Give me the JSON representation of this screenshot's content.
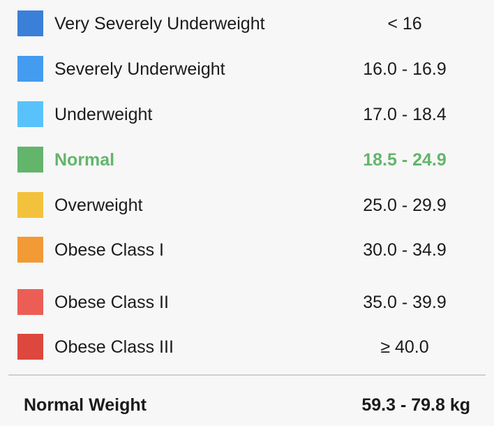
{
  "bmi_table": {
    "rows": [
      {
        "category": "Very Severely Underweight",
        "range": "< 16",
        "swatch_color": "#3a7fd8",
        "highlighted": false
      },
      {
        "category": "Severely Underweight",
        "range": "16.0 - 16.9",
        "swatch_color": "#449cf0",
        "highlighted": false
      },
      {
        "category": "Underweight",
        "range": "17.0 - 18.4",
        "swatch_color": "#5ac2fb",
        "highlighted": false
      },
      {
        "category": "Normal",
        "range": "18.5 - 24.9",
        "swatch_color": "#63b56c",
        "highlighted": true
      },
      {
        "category": "Overweight",
        "range": "25.0 - 29.9",
        "swatch_color": "#f3c23c",
        "highlighted": false
      },
      {
        "category": "Obese Class I",
        "range": "30.0 - 34.9",
        "swatch_color": "#f29a35",
        "highlighted": false
      },
      {
        "category": "Obese Class II",
        "range": "35.0 - 39.9",
        "swatch_color": "#ec5e55",
        "highlighted": false
      },
      {
        "category": "Obese Class III",
        "range": "≥ 40.0",
        "swatch_color": "#dd473e",
        "highlighted": false
      }
    ],
    "highlight_color": "#63b56c",
    "text_color": "#1b1b1b"
  },
  "summary": {
    "label": "Normal Weight",
    "value": "59.3 - 79.8 kg"
  }
}
